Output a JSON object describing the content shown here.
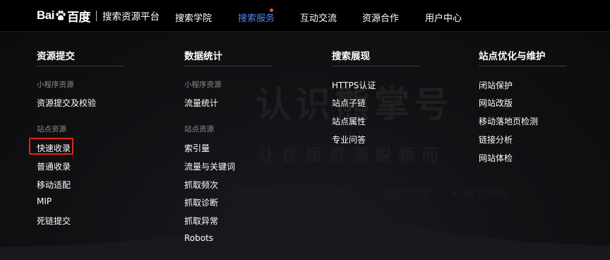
{
  "header": {
    "logo_text_left": "Bai",
    "logo_text_right": "百度",
    "platform_name": "搜索资源平台",
    "nav": [
      {
        "label": "搜索学院"
      },
      {
        "label": "搜索服务"
      },
      {
        "label": "互动交流"
      },
      {
        "label": "资源合作"
      },
      {
        "label": "用户中心"
      }
    ],
    "active_nav": "搜索服务"
  },
  "menu": {
    "columns": [
      {
        "title": "资源提交",
        "groups": [
          {
            "label": "小程序资源",
            "items": [
              "资源提交及校验"
            ]
          },
          {
            "label": "站点资源",
            "items": [
              "快速收录",
              "普通收录",
              "移动适配",
              "MIP",
              "死链提交"
            ]
          }
        ]
      },
      {
        "title": "数据统计",
        "groups": [
          {
            "label": "小程序资源",
            "items": [
              "流量统计"
            ]
          },
          {
            "label": "站点资源",
            "items": [
              "索引量",
              "流量与关键词",
              "抓取频次",
              "抓取诊断",
              "抓取异常",
              "Robots"
            ]
          }
        ]
      },
      {
        "title": "搜索展现",
        "groups": [
          {
            "label": "",
            "items": [
              "HTTPS认证",
              "站点子链",
              "站点属性",
              "专业问答"
            ]
          }
        ]
      },
      {
        "title": "站点优化与维护",
        "groups": [
          {
            "label": "",
            "items": [
              "闭站保护",
              "网站改版",
              "移动落地页检测",
              "链接分析",
              "网站体检"
            ]
          }
        ]
      }
    ],
    "highlighted_item": "快速收录"
  },
  "background": {
    "title": "认识熊掌号",
    "subtitle": "让优质资源脱颖而",
    "features": [
      "品牌赋能",
      "流量赋能",
      "运营赋能",
      "技术赋能"
    ]
  },
  "colors": {
    "active_nav": "#4e83f6",
    "notification_dot": "#f0493e",
    "highlight_border": "#e0241b",
    "group_label": "#8d8d8d"
  }
}
